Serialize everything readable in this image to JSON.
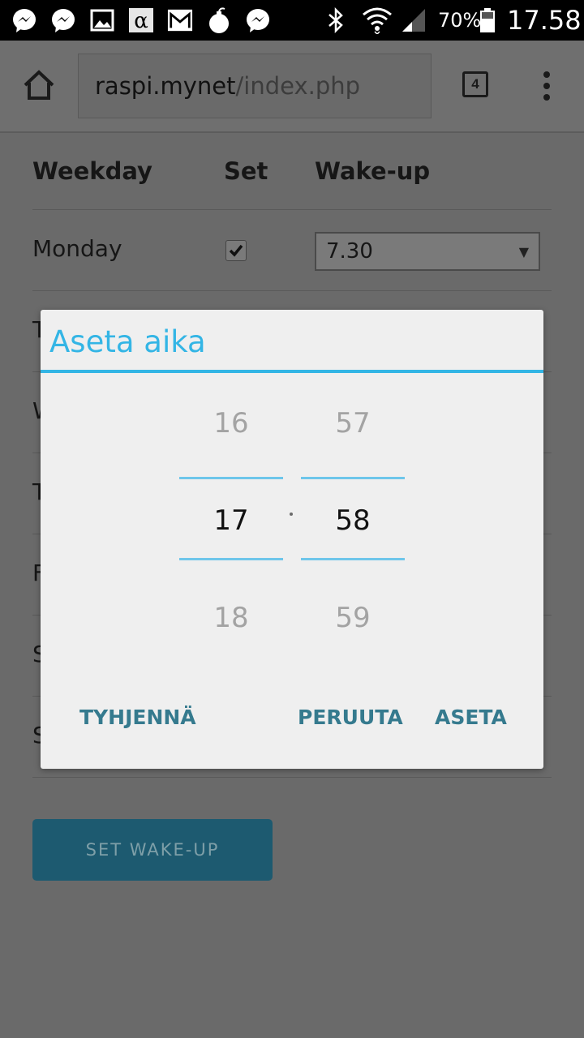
{
  "status_bar": {
    "battery": "70%",
    "time": "17.58",
    "left_icons": [
      "messenger-icon",
      "messenger-icon",
      "gallery-icon",
      "alpha-app-icon",
      "gmail-icon",
      "bomb-icon",
      "messenger-icon"
    ],
    "right_icons": [
      "bluetooth-icon",
      "wifi-icon",
      "signal-icon",
      "battery-icon"
    ]
  },
  "browser": {
    "url_host": "raspi.mynet",
    "url_path": "/index.php",
    "tab_count": "4"
  },
  "table": {
    "headers": {
      "weekday": "Weekday",
      "set": "Set",
      "wakeup": "Wake-up"
    },
    "rows": [
      {
        "day": "Monday",
        "set_checked": true,
        "wakeup": "7.30"
      },
      {
        "day": "T"
      },
      {
        "day": "W"
      },
      {
        "day": "T"
      },
      {
        "day": "F"
      },
      {
        "day": "S"
      },
      {
        "day": "S"
      }
    ]
  },
  "set_wakeup_button": "SET WAKE-UP",
  "time_dialog": {
    "title": "Aseta aika",
    "hours": {
      "prev": "16",
      "selected": "17",
      "next": "18"
    },
    "minutes": {
      "prev": "57",
      "selected": "58",
      "next": "59"
    },
    "buttons": {
      "clear": "TYHJENNÄ",
      "cancel": "PERUUTA",
      "set": "ASETA"
    }
  },
  "colors": {
    "accent": "#33b5e5",
    "dialog_button": "#357a8e",
    "primary_button": "#1d5a70"
  }
}
